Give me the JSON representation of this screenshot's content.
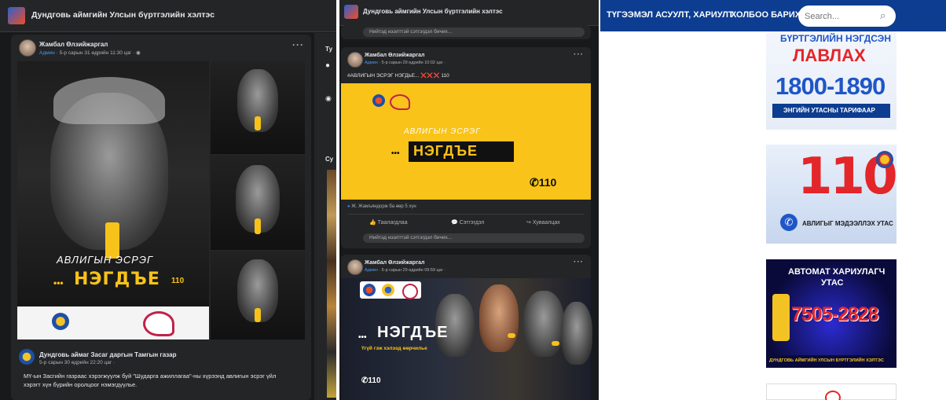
{
  "panel1": {
    "page_title": "Дундговь аймгийн Улсын бүртгэлийн хэлтэс",
    "post": {
      "author": "Жамбал Өлзийжаргал",
      "badge": "Админ",
      "meta": "· 5-р сарын 31 өдрийн 11:30 цаг ·",
      "slogan": "АВЛИГЫН ЭСРЭГ",
      "brand": "НЭГДЪЕ",
      "brand_prefix": "•••",
      "phone_tag": "110",
      "shared_author": "Дундговь аймаг Засаг даргын Тамгын газар",
      "shared_meta": "5-р сарын 30 өдрийн 22:20 цаг ·",
      "text_line1": "МҮ-ын Засгийн газраас хэрэгжүүлж буй \"Шударга ажиллагаа\"-ны хүрээнд авлигын эсрэг үйл",
      "text_line2": "хэрэгт хүн бүрийн оролцоог нэмэгдүүлье."
    },
    "side_labels": [
      "Ту",
      "Су"
    ],
    "colors": {
      "bg": "#18191a",
      "card": "#242526",
      "accent": "#f7c21a"
    }
  },
  "panel2": {
    "page_title": "Дундговь аймгийн Улсын бүртгэлийн хэлтэс",
    "comment_placeholder": "Нийтэд нээлттэй сэтгэгдэл бичих...",
    "post1": {
      "author": "Жамбал Өлзийжаргал",
      "badge": "Админ",
      "meta": "· 5-р сарын 29 өдрийн 10:02 цаг ·",
      "text": "#АВЛИГЫН ЭСРЭГ НЭГДЬЕ... ❌❌❌ 110",
      "slogan": "АВЛИГЫН ЭСРЭГ",
      "brand": "НЭГДЪЕ",
      "brand_prefix": "•••",
      "phone": "110",
      "reactions": "Ж. Жамъяндорж ба өөр 5 хүн",
      "actions": [
        "Таалагдлаа",
        "Сэтгэгдэл",
        "Хуваалцах"
      ]
    },
    "post2": {
      "author": "Жамбал Өлзийжаргал",
      "badge": "Админ",
      "meta": "· 5-р сарын 29 өдрийн 09:59 цаг ·",
      "brand": "НЭГДЪЕ",
      "brand_prefix": "•••",
      "tagline": "Үгүй гэж хэлээд өөрчилье",
      "phone": "110"
    }
  },
  "panel3": {
    "nav": [
      "ТҮГЭЭМЭЛ АСУУЛТ, ХАРИУЛТ",
      "ХОЛБОО БАРИХ"
    ],
    "search_placeholder": "Search...",
    "banner1": {
      "line1": "БҮРТГЭЛИЙН НЭГДСЭН",
      "line2": "ЛАВЛАХ",
      "number": "1800-1890",
      "footer": "ЭНГИЙН УТАСНЫ ТАРИФААР"
    },
    "banner2": {
      "number": "110",
      "caption": "АВЛИГЫГ МЭДЭЭЛЛЭХ УТАС"
    },
    "banner3": {
      "line1": "АВТОМАТ ХАРИУЛАГЧ",
      "line2": "УТАС",
      "number": "7505-2828",
      "footer": "ДУНДГОВЬ АЙМГИЙН УЛСЫН БҮРТГЭЛИЙН ХЭЛТЭС"
    },
    "colors": {
      "nav": "#0c3d91",
      "blue_text": "#1f56c7",
      "red": "#e3262a"
    }
  }
}
